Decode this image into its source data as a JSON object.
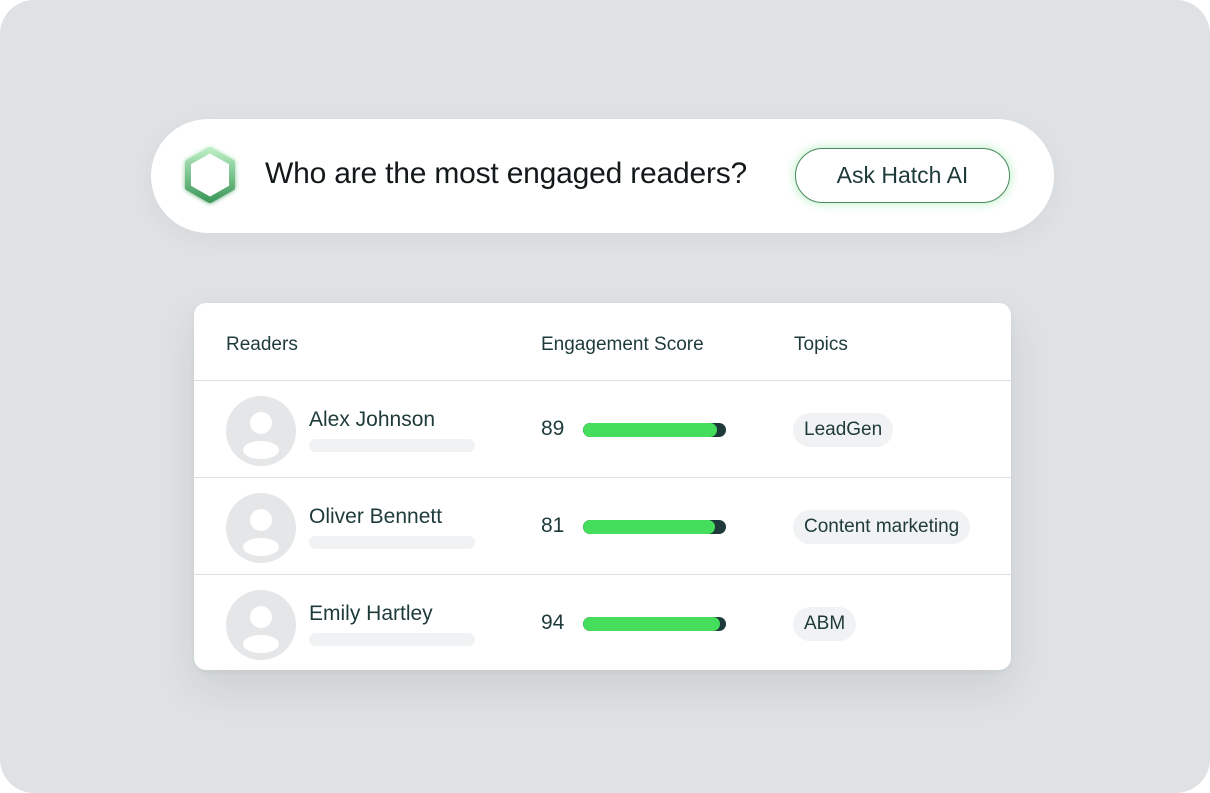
{
  "query": {
    "question": "Who are the most engaged readers?",
    "ask_button_label": "Ask Hatch AI",
    "logo_icon": "hexagon-icon"
  },
  "table": {
    "headers": {
      "readers": "Readers",
      "score": "Engagement Score",
      "topics": "Topics"
    },
    "rows": [
      {
        "name": "Alex Johnson",
        "score": "89",
        "score_fraction": 0.94,
        "topic": "LeadGen"
      },
      {
        "name": "Oliver Bennett",
        "score": "81",
        "score_fraction": 0.92,
        "topic": "Content marketing"
      },
      {
        "name": "Emily Hartley",
        "score": "94",
        "score_fraction": 0.96,
        "topic": "ABM"
      }
    ]
  },
  "colors": {
    "accent_green": "#44dd5c",
    "dark_teal": "#1f3a3a",
    "background": "#dfe2e4"
  }
}
